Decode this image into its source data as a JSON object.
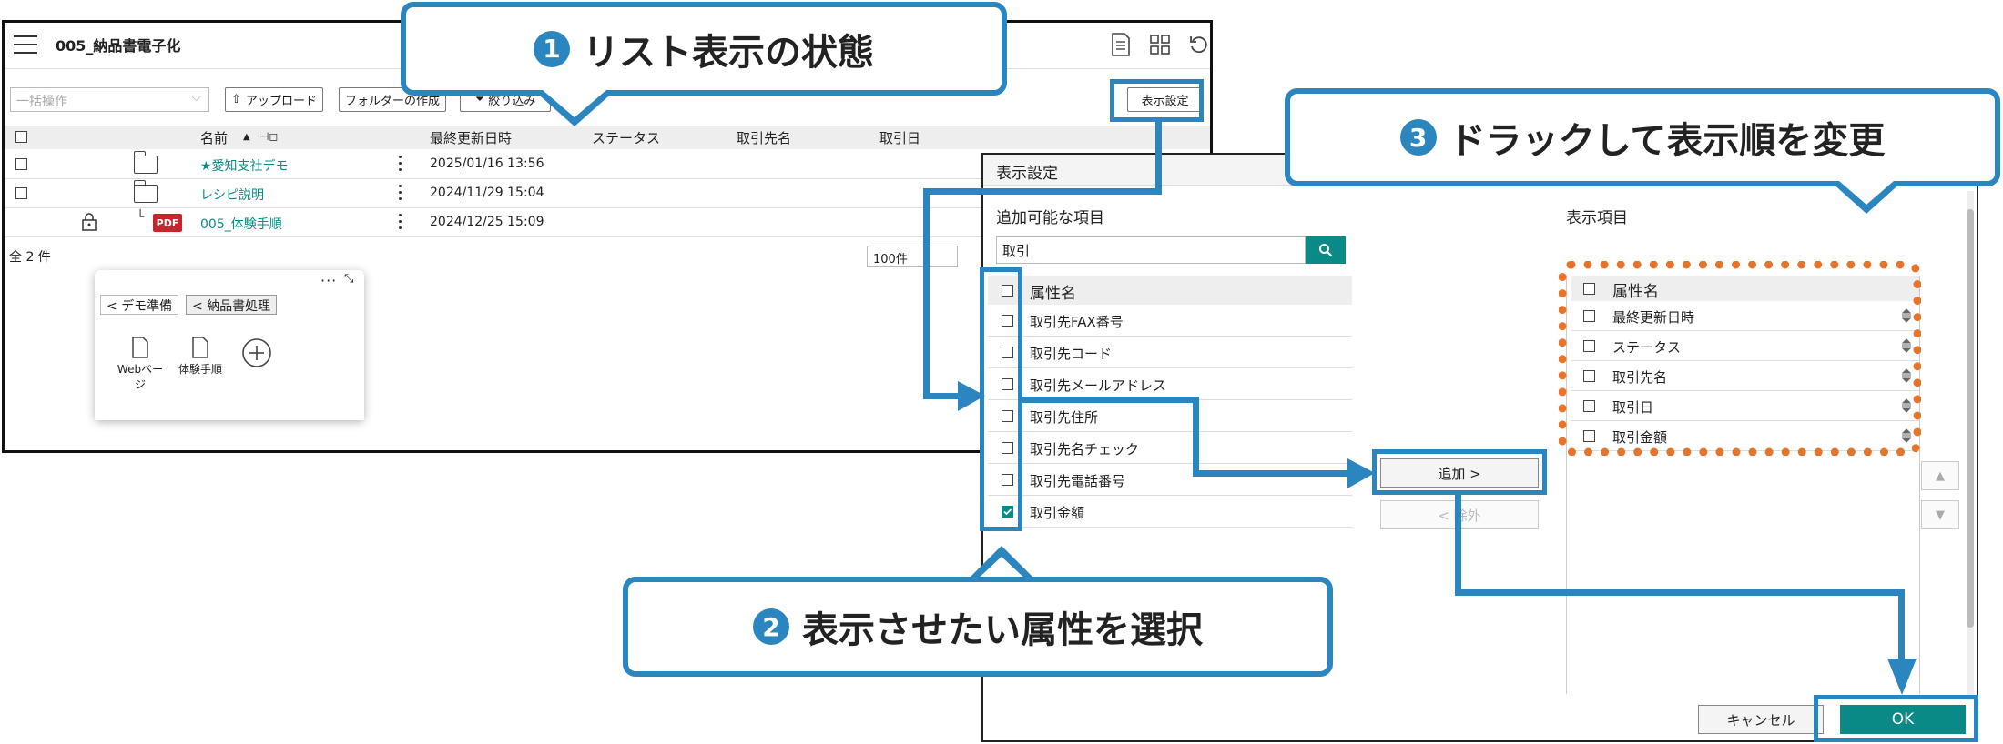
{
  "header": {
    "title": "005_納品書電子化",
    "icons": [
      "document-list-icon",
      "grid-icon",
      "refresh-icon"
    ]
  },
  "toolbar": {
    "bulk_placeholder": "一括操作",
    "upload_label": "アップロード",
    "create_folder_label": "フォルダーの作成",
    "filter_label": "絞り込み",
    "display_settings_label": "表示設定"
  },
  "table": {
    "columns": [
      "名前",
      "最終更新日時",
      "ステータス",
      "取引先名",
      "取引日"
    ],
    "rows": [
      {
        "name": "★愛知支社デモ",
        "date": "2025/01/16 13:56"
      },
      {
        "name": "レシピ説明",
        "date": "2024/11/29 15:04"
      },
      {
        "name": "005_体験手順",
        "date": "2024/12/25 15:09",
        "badge": "PDF"
      }
    ],
    "total": "全 2 件",
    "page_size": "100件"
  },
  "float_panel": {
    "tabs": [
      "デモ準備",
      "納品書処理"
    ],
    "items": [
      "Webページ",
      "体験手順"
    ]
  },
  "dialog": {
    "title": "表示設定",
    "available_title": "追加可能な項目",
    "search_value": "取引",
    "attr_header": "属性名",
    "available_items": [
      {
        "label": "取引先FAX番号",
        "checked": false
      },
      {
        "label": "取引先コード",
        "checked": false
      },
      {
        "label": "取引先メールアドレス",
        "checked": false
      },
      {
        "label": "取引先住所",
        "checked": false
      },
      {
        "label": "取引先名チェック",
        "checked": false
      },
      {
        "label": "取引先電話番号",
        "checked": false
      },
      {
        "label": "取引金額",
        "checked": true
      }
    ],
    "add_label": "追加 >",
    "remove_label": "< 除外",
    "display_title": "表示項目",
    "display_items": [
      "最終更新日時",
      "ステータス",
      "取引先名",
      "取引日",
      "取引金額"
    ],
    "cancel_label": "キャンセル",
    "ok_label": "OK"
  },
  "callouts": {
    "c1": {
      "num": "1",
      "text": "リスト表示の状態"
    },
    "c2": {
      "num": "2",
      "text": "表示させたい属性を選択"
    },
    "c3": {
      "num": "3",
      "text": "ドラックして表示順を変更"
    }
  },
  "colors": {
    "accent": "#2b86bf",
    "teal": "#0a8a87",
    "orange": "#e8742c"
  }
}
